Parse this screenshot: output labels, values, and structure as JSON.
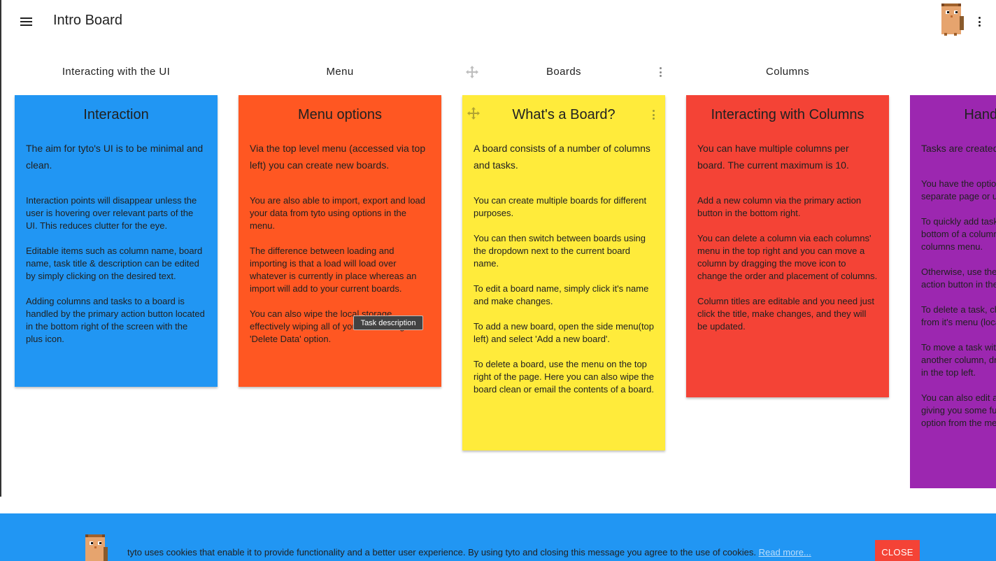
{
  "header": {
    "board_title": "Intro Board"
  },
  "icons": {
    "menu": "hamburger-menu-icon",
    "more": "more-vert-icon",
    "move": "move-arrows-icon",
    "avatar": "tyto-owl-icon"
  },
  "colors": {
    "blue": "#2196f3",
    "orange": "#ff5722",
    "yellow": "#ffeb3b",
    "red": "#f44336",
    "purple": "#9c27b0"
  },
  "columns": [
    {
      "title": "Interacting with the UI",
      "card": {
        "title": "Interaction",
        "p1": "The aim for tyto's UI is to be minimal and clean.",
        "paras": [
          "Interaction points will disappear unless the user is hovering over relevant parts of the UI. This reduces clutter for the eye.",
          "Editable items such as column name, board name, task title & description can be edited by simply clicking on the desired text.",
          "Adding columns and tasks to a board is handled by the primary action button located in the bottom right of the screen with the plus icon."
        ]
      }
    },
    {
      "title": "Menu",
      "card": {
        "title": "Menu options",
        "p1": "Via the top level menu (accessed via top left) you can create new boards.",
        "paras": [
          "You are also able to import, export and load your data from tyto using options in the menu.",
          "The difference between loading and importing is that a load will load over whatever is currently in place whereas an import will add to your current boards.",
          "You can also wipe the local storage effectively wiping all of your data using the 'Delete Data' option."
        ]
      }
    },
    {
      "title": "Boards",
      "card": {
        "title": "What's a Board?",
        "p1": "A board consists of a number of columns and tasks.",
        "paras": [
          "You can create multiple boards for different purposes.",
          "You can then switch between boards using the dropdown next to the current board name.",
          "To edit a board name, simply click it's name and make changes.",
          "To add a new board, open the side menu(top left) and select 'Add a new board'.",
          "To delete a board, use the menu on the top right of the page. Here you can also wipe the board clean or email the contents of a board."
        ]
      }
    },
    {
      "title": "Columns",
      "card": {
        "title": "Interacting with Columns",
        "p1": "You can have multiple columns per board. The current maximum is 10.",
        "paras": [
          "Add a new column via the primary action button in the bottom right.",
          "You can delete a column via each columns' menu in the top right and you can move a column by dragging the move icon to change the order and placement of columns.",
          "Column titles are editable and you need just click the title, make changes, and they will be updated."
        ]
      }
    },
    {
      "title": "",
      "card": {
        "title": "Handling Tasks",
        "p1": "Tasks are created in one of two ways.",
        "paras": [
          "You have the option to add a task on a separate page or using the quick add.",
          "To quickly add tasks use the bar at the bottom of a column or the add task in the columns menu.",
          "Otherwise, use the add task via the primary action button in the bottom right.",
          "To delete a task, choose the delete option from it's menu (located top right).",
          "To move a task within a column or move it to another column, drag it using the move icon in the top left.",
          "You can also edit a task by clicking it's title, giving you some further options via the edit option from the menu."
        ]
      }
    }
  ],
  "tooltip": {
    "text": "Task description"
  },
  "cookie": {
    "text": "tyto uses cookies that enable it to provide functionality and a better user experience. By using tyto and closing this message you agree to the use of cookies.",
    "link": "Read more...",
    "close_label": "CLOSE"
  }
}
